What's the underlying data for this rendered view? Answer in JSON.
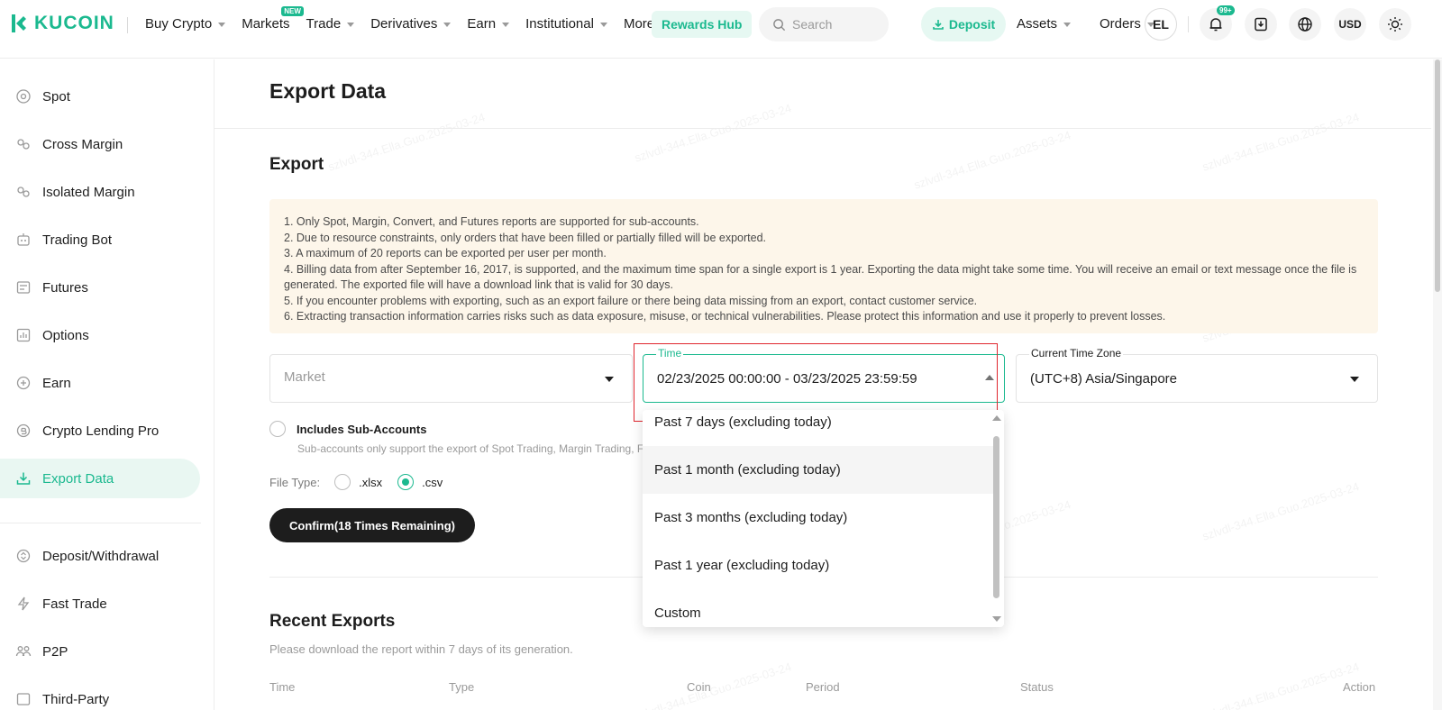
{
  "brand": {
    "name": "KUCOIN",
    "accent": "#1bb98f"
  },
  "nav": {
    "items": [
      {
        "label": "Buy Crypto",
        "caret": true
      },
      {
        "label": "Markets",
        "caret": false,
        "badge": "NEW"
      },
      {
        "label": "Trade",
        "caret": true
      },
      {
        "label": "Derivatives",
        "caret": true
      },
      {
        "label": "Earn",
        "caret": true
      },
      {
        "label": "Institutional",
        "caret": true
      },
      {
        "label": "More",
        "caret": true
      }
    ],
    "rewards_label": "Rewards Hub",
    "search_placeholder": "Search",
    "deposit_label": "Deposit",
    "assets_label": "Assets",
    "orders_label": "Orders",
    "avatar_initials": "EL",
    "notification_count": "99+",
    "currency": "USD"
  },
  "sidebar": {
    "items": [
      {
        "label": "Spot",
        "icon": "spot-icon"
      },
      {
        "label": "Cross Margin",
        "icon": "cross-margin-icon"
      },
      {
        "label": "Isolated Margin",
        "icon": "isolated-margin-icon"
      },
      {
        "label": "Trading Bot",
        "icon": "bot-icon"
      },
      {
        "label": "Futures",
        "icon": "futures-icon"
      },
      {
        "label": "Options",
        "icon": "options-icon"
      },
      {
        "label": "Earn",
        "icon": "earn-icon"
      },
      {
        "label": "Crypto Lending Pro",
        "icon": "lending-icon"
      },
      {
        "label": "Export Data",
        "icon": "export-icon",
        "active": true
      },
      {
        "label": "Deposit/Withdrawal",
        "icon": "deposit-withdrawal-icon"
      },
      {
        "label": "Fast Trade",
        "icon": "lightning-icon"
      },
      {
        "label": "P2P",
        "icon": "p2p-icon"
      },
      {
        "label": "Third-Party",
        "icon": "third-party-icon"
      }
    ]
  },
  "main": {
    "page_title": "Export Data",
    "section_title": "Export",
    "notices": [
      "1. Only Spot, Margin, Convert, and Futures reports are supported for sub-accounts.",
      "2. Due to resource constraints, only orders that have been filled or partially filled will be exported.",
      "3. A maximum of 20 reports can be exported per user per month.",
      "4. Billing data from after September 16, 2017, is supported, and the maximum time span for a single export is 1 year. Exporting the data might take some time. You will receive an email or text message once the file is generated. The exported file will have a download link that is valid for 30 days.",
      "5. If you encounter problems with exporting, such as an export failure or there being data missing from an export, contact customer service.",
      "6. Extracting transaction information carries risks such as data exposure, misuse, or technical vulnerabilities. Please protect this information and use it properly to prevent losses."
    ],
    "market": {
      "placeholder": "Market"
    },
    "time": {
      "label": "Time",
      "value": "02/23/2025 00:00:00 - 03/23/2025 23:59:59"
    },
    "timezone": {
      "label": "Current Time Zone",
      "value": "(UTC+8) Asia/Singapore"
    },
    "sub_accounts": {
      "label": "Includes Sub-Accounts",
      "note": "Sub-accounts only support the export of Spot Trading, Margin Trading, Futures"
    },
    "file_type": {
      "label": "File Type:",
      "options": [
        ".xlsx",
        ".csv"
      ],
      "selected": ".csv"
    },
    "confirm_label": "Confirm(18 Times Remaining)",
    "recent": {
      "title": "Recent Exports",
      "note": "Please download the report within 7 days of its generation.",
      "columns": [
        "Time",
        "Type",
        "Coin",
        "Period",
        "Status",
        "Action"
      ]
    }
  },
  "dropdown": {
    "options": [
      "Past 7 days (excluding today)",
      "Past 1 month (excluding today)",
      "Past 3 months (excluding today)",
      "Past 1 year (excluding today)",
      "Custom"
    ],
    "hovered": "Past 1 month (excluding today)"
  }
}
